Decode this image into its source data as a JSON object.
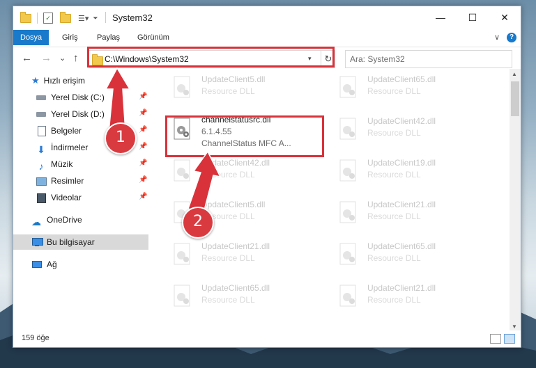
{
  "window": {
    "title": "System32",
    "minimize": "—",
    "maximize": "☐",
    "close": "✕"
  },
  "ribbon": {
    "tabs": [
      {
        "label": "Dosya",
        "active": true
      },
      {
        "label": "Giriş"
      },
      {
        "label": "Paylaş"
      },
      {
        "label": "Görünüm"
      }
    ],
    "collapse": "∨",
    "help": "?"
  },
  "address": {
    "back": "←",
    "forward": "→",
    "recent": "⌄",
    "up": "↑",
    "path": "C:\\Windows\\System32",
    "dropdown": "▾",
    "refresh": "↻",
    "search_placeholder": "Ara: System32"
  },
  "nav": {
    "quick_access": "Hızlı erişim",
    "items": [
      {
        "label": "Yerel Disk (C:)",
        "icon": "drive-icon"
      },
      {
        "label": "Yerel Disk (D:)",
        "icon": "drive-icon"
      },
      {
        "label": "Belgeler",
        "icon": "documents-icon"
      },
      {
        "label": "İndirmeler",
        "icon": "downloads-icon"
      },
      {
        "label": "Müzik",
        "icon": "music-icon"
      },
      {
        "label": "Resimler",
        "icon": "pictures-icon"
      },
      {
        "label": "Videolar",
        "icon": "videos-icon"
      }
    ],
    "pin": "📌",
    "onedrive": "OneDrive",
    "this_pc": "Bu bilgisayar",
    "network": "Ağ"
  },
  "files": {
    "highlighted": {
      "name": "channelstatusrc.dll",
      "version": "6.1.4.55",
      "description": "ChannelStatus MFC A..."
    },
    "left_column": [
      {
        "name": "UpdateClient5.dll",
        "desc": "Resource DLL"
      },
      {
        "name": "UpdateClient42.dll",
        "desc": "Resource DLL"
      },
      {
        "name": "UpdateClient5.dll",
        "desc": "Resource DLL"
      },
      {
        "name": "UpdateClient21.dll",
        "desc": "Resource DLL"
      },
      {
        "name": "UpdateClient65.dll",
        "desc": "Resource DLL"
      }
    ],
    "right_column": [
      {
        "name": "UpdateClient65.dll",
        "desc": "Resource DLL"
      },
      {
        "name": "UpdateClient42.dll",
        "desc": "Resource DLL"
      },
      {
        "name": "UpdateClient19.dll",
        "desc": "Resource DLL"
      },
      {
        "name": "UpdateClient21.dll",
        "desc": "Resource DLL"
      },
      {
        "name": "UpdateClient65.dll",
        "desc": "Resource DLL"
      },
      {
        "name": "UpdateClient21.dll",
        "desc": "Resource DLL"
      }
    ]
  },
  "status": {
    "count": "159 öğe"
  },
  "annotations": {
    "step1": "1",
    "step2": "2",
    "color": "#d9323a"
  }
}
